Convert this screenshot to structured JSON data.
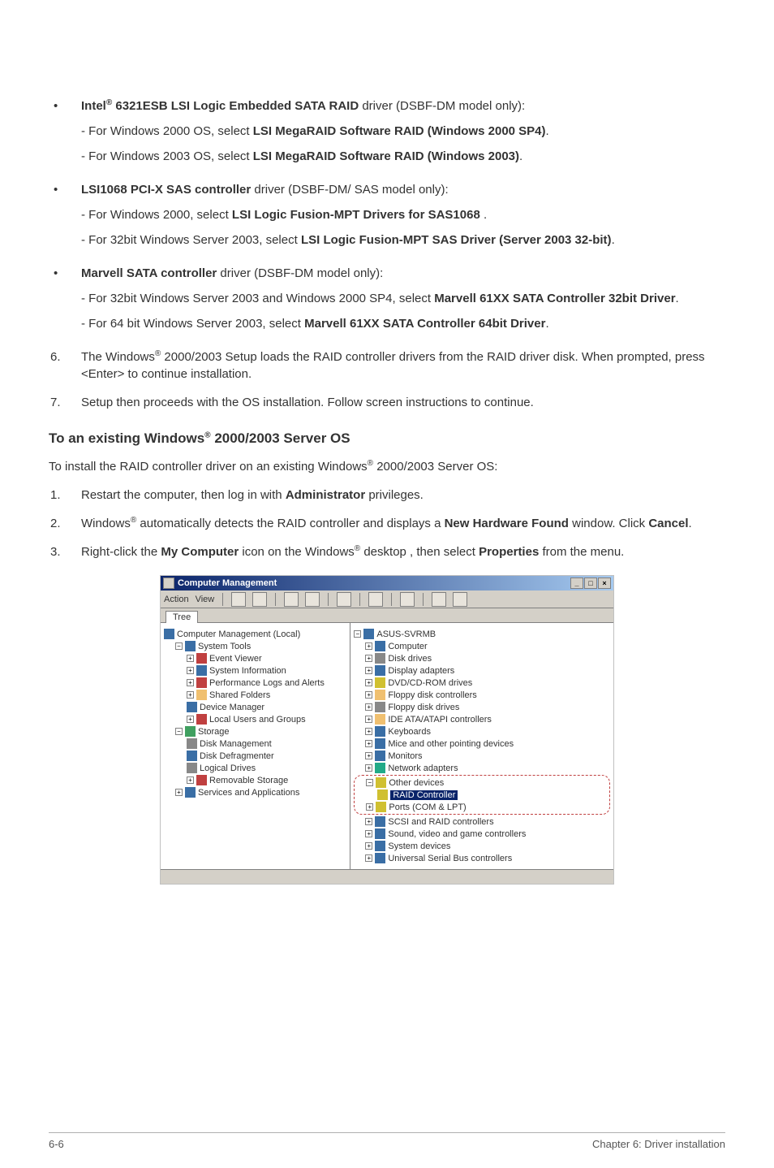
{
  "items": {
    "b1": {
      "lead": "Intel",
      "sup": "®",
      "bold_cont": " 6321ESB LSI Logic Embedded SATA RAID",
      "tail": " driver (DSBF-DM model only):",
      "sub1_pre": "- For Windows 2000 OS, select ",
      "sub1_bold": "LSI MegaRAID Software RAID (Windows 2000 SP4)",
      "sub1_post": ".",
      "sub2_pre": "- For Windows 2003 OS, select ",
      "sub2_bold": "LSI MegaRAID Software RAID (Windows 2003)",
      "sub2_post": "."
    },
    "b2": {
      "bold": "LSI1068 PCI-X SAS controller",
      "tail": " driver (DSBF-DM/ SAS model only):",
      "sub1_pre": "- For Windows 2000, select ",
      "sub1_bold": "LSI Logic Fusion-MPT Drivers for SAS1068",
      "sub1_post": " .",
      "sub2_pre": "- For 32bit Windows Server 2003, select ",
      "sub2_bold": "LSI Logic Fusion-MPT SAS Driver (Server 2003 32-bit)",
      "sub2_post": "."
    },
    "b3": {
      "bold": "Marvell SATA controller",
      "tail": " driver (DSBF-DM model only):",
      "sub1_pre": "- For 32bit Windows Server 2003 and Windows 2000 SP4, select ",
      "sub1_bold": "Marvell 61XX SATA Controller 32bit Driver",
      "sub1_post": ".",
      "sub2_pre": "- For 64 bit Windows Server 2003, select ",
      "sub2_bold": "Marvell 61XX SATA Controller 64bit Driver",
      "sub2_post": "."
    },
    "n6": {
      "num": "6.",
      "pre": "The Windows",
      "sup": "®",
      "post": " 2000/2003 Setup loads the RAID controller drivers from the RAID driver disk. When prompted, press <Enter> to continue installation."
    },
    "n7": {
      "num": "7.",
      "text": "Setup then proceeds with the OS installation. Follow screen instructions to continue."
    }
  },
  "heading": {
    "pre": "To an existing Windows",
    "sup": "®",
    "post": " 2000/2003 Server OS"
  },
  "intro": {
    "pre": "To install the RAID controller driver on an existing Windows",
    "sup": "®",
    "post": " 2000/2003 Server OS:"
  },
  "steps": {
    "s1": {
      "num": "1.",
      "pre": "Restart the computer, then log in with ",
      "bold": "Administrator",
      "post": " privileges."
    },
    "s2": {
      "num": "2.",
      "pre": "Windows",
      "sup": "®",
      "mid": " automatically detects the RAID controller and displays a ",
      "bold1": "New Hardware Found",
      "mid2": " window. Click ",
      "bold2": "Cancel",
      "post": "."
    },
    "s3": {
      "num": "3.",
      "pre": "Right-click the ",
      "bold1": "My Computer",
      "mid": " icon on the Windows",
      "sup": "®",
      "mid2": " desktop , then select ",
      "bold2": "Properties",
      "post": " from the menu."
    }
  },
  "shot": {
    "title": "Computer Management",
    "menu_action": "Action",
    "menu_view": "View",
    "tab_tree": "Tree",
    "left_root": "Computer Management (Local)",
    "left_systools": "System Tools",
    "left_eventviewer": "Event Viewer",
    "left_sysinfo": "System Information",
    "left_perflogs": "Performance Logs and Alerts",
    "left_shared": "Shared Folders",
    "left_devmgr": "Device Manager",
    "left_localusers": "Local Users and Groups",
    "left_storage": "Storage",
    "left_diskmgmt": "Disk Management",
    "left_diskdefrag": "Disk Defragmenter",
    "left_logical": "Logical Drives",
    "left_removable": "Removable Storage",
    "left_services": "Services and Applications",
    "right_root": "ASUS-SVRMB",
    "r_computer": "Computer",
    "r_disk": "Disk drives",
    "r_display": "Display adapters",
    "r_dvd": "DVD/CD-ROM drives",
    "r_floppyctrl": "Floppy disk controllers",
    "r_floppy": "Floppy disk drives",
    "r_ide": "IDE ATA/ATAPI controllers",
    "r_keyb": "Keyboards",
    "r_mice": "Mice and other pointing devices",
    "r_monitors": "Monitors",
    "r_network": "Network adapters",
    "r_other": "Other devices",
    "r_raid": "RAID Controller",
    "r_ports": "Ports (COM & LPT)",
    "r_scsi": "SCSI and RAID controllers",
    "r_sound": "Sound, video and game controllers",
    "r_system": "System devices",
    "r_usb": "Universal Serial Bus controllers"
  },
  "footer": {
    "left": "6-6",
    "right": "Chapter 6: Driver installation"
  }
}
